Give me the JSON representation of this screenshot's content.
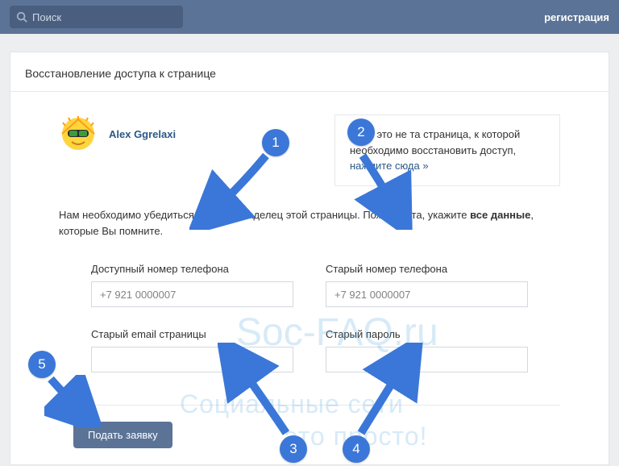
{
  "topbar": {
    "search_placeholder": "Поиск",
    "register": "регистрация"
  },
  "title": "Восстановление доступа к странице",
  "profile": {
    "name": "Alex Ggrelaxi"
  },
  "notice": {
    "prefix": "Если это не та страница, к которой необходимо восстановить доступ, ",
    "link": "нажмите сюда »"
  },
  "instruction": {
    "line1_a": "Нам необходимо убедиться, что Вы владелец этой страницы. Пожалуйста, укажите ",
    "line1_b": "все данные",
    "line1_c": ", которые Вы помните."
  },
  "fields": {
    "available_phone": {
      "label": "Доступный номер телефона",
      "placeholder": "+7 921 0000007"
    },
    "old_phone": {
      "label": "Старый номер телефона",
      "placeholder": "+7 921 0000007"
    },
    "old_email": {
      "label": "Старый email страницы",
      "placeholder": ""
    },
    "old_password": {
      "label": "Старый пароль",
      "placeholder": ""
    }
  },
  "submit": "Подать заявку",
  "annotations": {
    "b1": "1",
    "b2": "2",
    "b3": "3",
    "b4": "4",
    "b5": "5"
  },
  "watermark": {
    "w1": "Soc-FAQ.ru",
    "w2": "Социальные сети",
    "w3": "это просто!"
  }
}
